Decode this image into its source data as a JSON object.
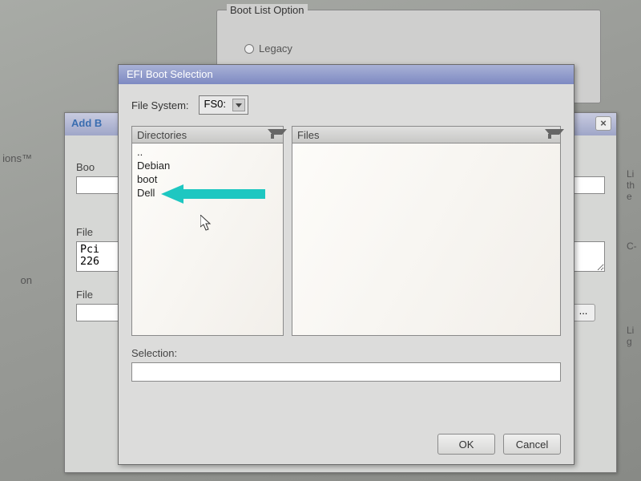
{
  "background": {
    "group_title": "Boot List Option",
    "radio_legacy": "Legacy",
    "left_cropped_label_1": "ions™",
    "left_cropped_label_2": "on",
    "right_crop_1": "Li\nth\ne",
    "right_crop_2": "C-",
    "right_crop_3": "Li\ng"
  },
  "add_dialog": {
    "title": "Add B",
    "label_boot": "Boo",
    "label_file": "File",
    "label_file2": "File",
    "path_value": "Pci\n226",
    "close": "×",
    "browse": "..."
  },
  "efi_dialog": {
    "title": "EFI Boot Selection",
    "file_system_label": "File System:",
    "file_system_value": "FS0:",
    "directories_label": "Directories",
    "files_label": "Files",
    "directories": [
      "..",
      "Debian",
      "boot",
      "Dell"
    ],
    "selection_label": "Selection:",
    "selection_value": "",
    "ok": "OK",
    "cancel": "Cancel"
  }
}
